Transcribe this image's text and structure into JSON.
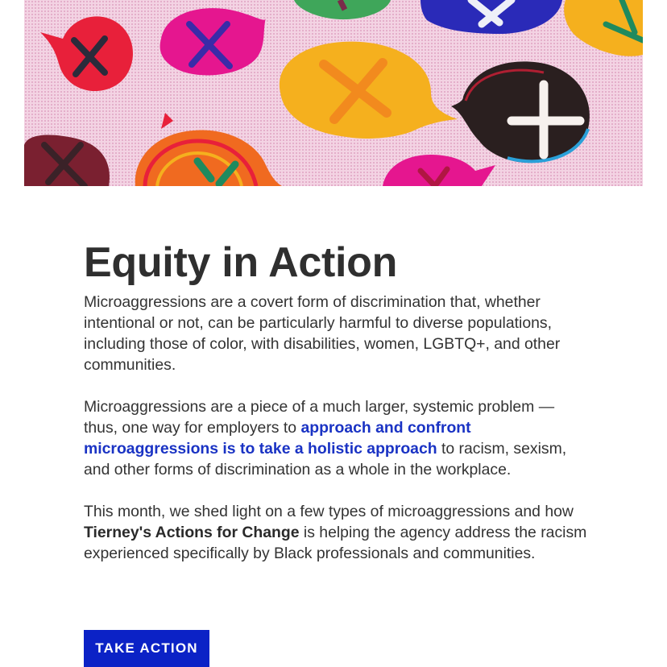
{
  "hero": {
    "image_alt": "Colorful speech bubbles with X marks and fingerprints on a pink halftone background",
    "colors": {
      "background": "#f0c8dc",
      "red": "#e8203a",
      "magenta": "#e5168f",
      "yellow": "#f5b01e",
      "blue": "#2a2ab8",
      "black": "#2a1f1f"
    }
  },
  "article": {
    "title": "Equity in Action",
    "p1": "Microaggressions are a covert form of discrimination that, whether intentional or not, can be particularly harmful to diverse populations, including those of color, with disabilities, women, LGBTQ+, and other communities.",
    "p2_before": "Microaggressions are a piece of a much larger, systemic problem — thus, one way for employers to ",
    "p2_link": "approach and confront microaggressions is to take a holistic approach",
    "p2_after": " to racism, sexism, and other forms of discrimination as a whole in the workplace.",
    "p3_before": "This month, we shed light on a few types of microaggressions and how ",
    "p3_bold": "Tierney's Actions for Change",
    "p3_after": " is helping the agency address the racism experienced specifically by Black professionals and communities."
  },
  "cta": {
    "label": "TAKE ACTION",
    "color": "#0b22c6"
  }
}
